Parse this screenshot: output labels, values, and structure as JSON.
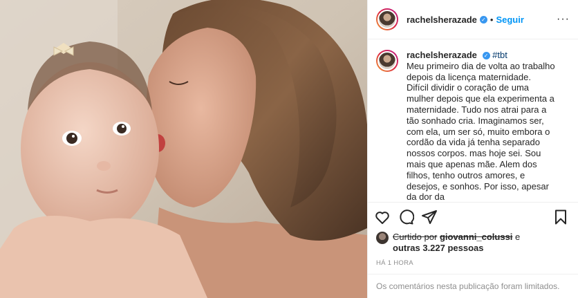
{
  "post": {
    "header": {
      "username": "rachelsherazade",
      "verified_symbol": "✓",
      "separator": "•",
      "follow_label": "Seguir",
      "more_symbol": "···"
    },
    "caption": {
      "username": "rachelsherazade",
      "verified_symbol": "✓",
      "hashtag": "#tbt",
      "text": "Meu primeiro dia de volta ao trabalho depois da licença maternidade. Difícil dividir o coração de uma mulher depois que ela experimenta a maternidade. Tudo nos atrai para a tão sonhado cria. Imaginamos ser, com ela, um ser só, muito embora o cordão da vida já tenha separado nossos corpos. mas hoje sei. Sou mais que apenas mãe. Alem dos filhos, tenho outros amores, e desejos, e sonhos. Por isso, apesar da dor da"
    },
    "actions": {
      "icons": [
        "heart-icon",
        "comment-icon",
        "share-icon",
        "bookmark-icon"
      ]
    },
    "likes": {
      "prefix": "Curtido por",
      "liker": "giovanni_colussi",
      "conjunction": "e",
      "others": "outras 3.227 pessoas"
    },
    "timestamp": "HÁ 1 HORA",
    "comments_limited": "Os comentários nesta publicação foram limitados."
  }
}
